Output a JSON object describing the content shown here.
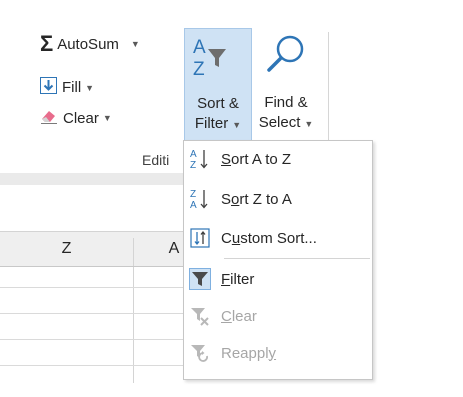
{
  "ribbon": {
    "autosum_label": "AutoSum",
    "fill_label": "Fill",
    "clear_label": "Clear",
    "sort_filter_line1": "Sort &",
    "sort_filter_line2": "Filter",
    "find_select_line1": "Find &",
    "find_select_line2": "Select",
    "group_label": "Editi"
  },
  "grid": {
    "column_z": "Z",
    "column_aa_partial": "A"
  },
  "menu": {
    "sort_az": {
      "prefix": "",
      "accel": "S",
      "rest": "ort A to Z"
    },
    "sort_za": {
      "prefix": "S",
      "accel": "o",
      "rest": "rt Z to A"
    },
    "custom_sort": {
      "prefix": "C",
      "accel": "u",
      "rest": "stom Sort..."
    },
    "filter": {
      "prefix": "",
      "accel": "F",
      "rest": "ilter"
    },
    "clear": {
      "prefix": "",
      "accel": "C",
      "rest": "lear"
    },
    "reapply": {
      "prefix": "Reappl",
      "accel": "y",
      "rest": ""
    }
  },
  "colors": {
    "accent_blue": "#2e75b6",
    "selected_bg": "#cfe2f4",
    "disabled_text": "#a6a6a6"
  },
  "icons": [
    "sigma-icon",
    "fill-down-icon",
    "eraser-icon",
    "sort-filter-icon",
    "magnifier-icon",
    "sort-az-icon",
    "sort-za-icon",
    "custom-sort-icon",
    "funnel-icon",
    "clear-filter-icon",
    "reapply-filter-icon"
  ]
}
